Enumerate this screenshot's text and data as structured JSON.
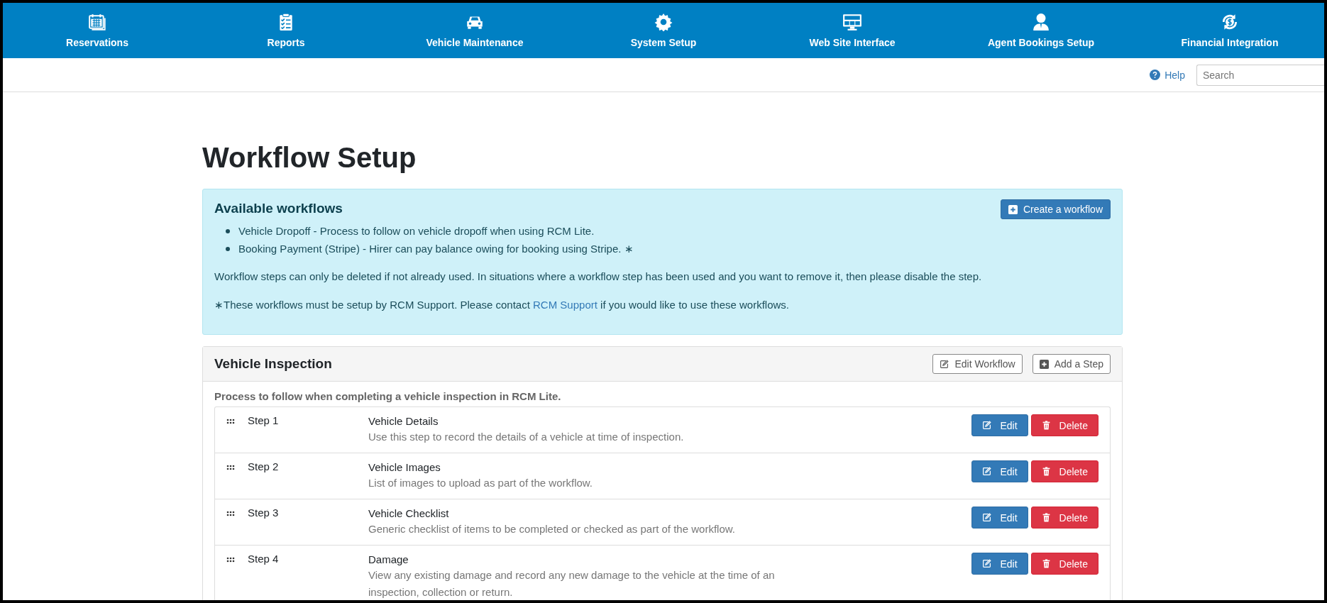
{
  "nav": [
    {
      "label": "Reservations"
    },
    {
      "label": "Reports"
    },
    {
      "label": "Vehicle Maintenance"
    },
    {
      "label": "System Setup"
    },
    {
      "label": "Web Site Interface"
    },
    {
      "label": "Agent Bookings Setup"
    },
    {
      "label": "Financial Integration"
    }
  ],
  "toolbar": {
    "help": "Help",
    "search": {
      "placeholder": "Search"
    }
  },
  "title": "Workflow Setup",
  "alert": {
    "heading": "Available workflows",
    "button": "Create a workflow",
    "items": [
      "Vehicle Dropoff - Process to follow on vehicle dropoff when using RCM Lite.",
      "Booking Payment (Stripe) - Hirer can pay balance owing for booking using Stripe. ∗"
    ],
    "note": "Workflow steps can only be deleted if not already used. In situations where a workflow step has been used and you want to remove it, then please disable the step.",
    "support": {
      "before": "∗These workflows must be setup by RCM Support. Please contact",
      "link": "RCM Support",
      "after": "if you would like to use these workflows."
    }
  },
  "panel": {
    "title": "Vehicle Inspection",
    "buttons": [
      "Edit Workflow",
      "Add a Step"
    ],
    "description": "Process to follow when completing a vehicle inspection in RCM Lite.",
    "steps": [
      {
        "step": "Step 1",
        "name": "Vehicle Details",
        "description": "Use this step to record the details of a vehicle at time of inspection.",
        "edit": "Edit",
        "delete": "Delete"
      },
      {
        "step": "Step 2",
        "name": "Vehicle Images",
        "description": "List of images to upload as part of the workflow.",
        "edit": "Edit",
        "delete": "Delete"
      },
      {
        "step": "Step 3",
        "name": "Vehicle Checklist",
        "description": "Generic checklist of items to be completed or checked as part of the workflow.",
        "edit": "Edit",
        "delete": "Delete"
      },
      {
        "step": "Step 4",
        "name": "Damage",
        "description": "View any existing damage and record any new damage to the vehicle at the time of an inspection, collection or return.",
        "edit": "Edit",
        "delete": "Delete"
      }
    ]
  }
}
